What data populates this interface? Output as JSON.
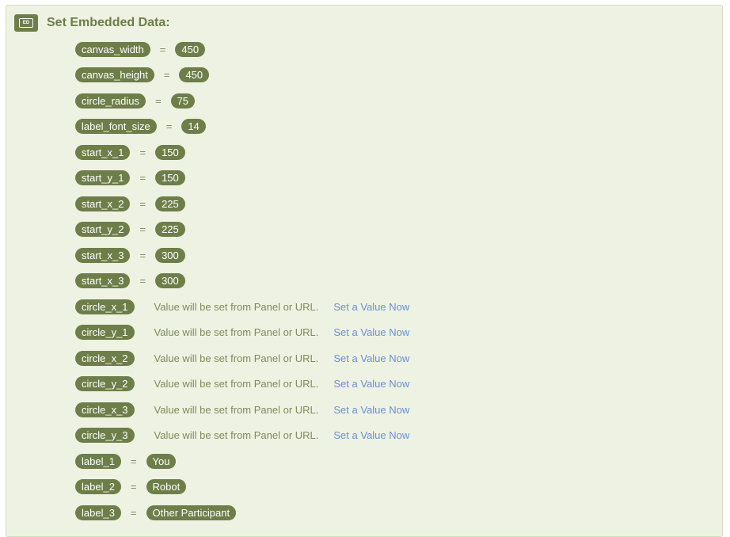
{
  "header": {
    "badge": "ED",
    "title": "Set Embedded Data:"
  },
  "fields": [
    {
      "name": "canvas_width",
      "value": "450"
    },
    {
      "name": "canvas_height",
      "value": "450"
    },
    {
      "name": "circle_radius",
      "value": "75"
    },
    {
      "name": "label_font_size",
      "value": "14"
    },
    {
      "name": "start_x_1",
      "value": "150"
    },
    {
      "name": "start_y_1",
      "value": "150"
    },
    {
      "name": "start_x_2",
      "value": "225"
    },
    {
      "name": "start_y_2",
      "value": "225"
    },
    {
      "name": "start_x_3",
      "value": "300"
    },
    {
      "name": "start_x_3",
      "value": "300"
    },
    {
      "name": "circle_x_1",
      "placeholder": "Value will be set from Panel or URL.",
      "action": "Set a Value Now"
    },
    {
      "name": "circle_y_1",
      "placeholder": "Value will be set from Panel or URL.",
      "action": "Set a Value Now"
    },
    {
      "name": "circle_x_2",
      "placeholder": "Value will be set from Panel or URL.",
      "action": "Set a Value Now"
    },
    {
      "name": "circle_y_2",
      "placeholder": "Value will be set from Panel or URL.",
      "action": "Set a Value Now"
    },
    {
      "name": "circle_x_3",
      "placeholder": "Value will be set from Panel or URL.",
      "action": "Set a Value Now"
    },
    {
      "name": "circle_y_3",
      "placeholder": "Value will be set from Panel or URL.",
      "action": "Set a Value Now"
    },
    {
      "name": "label_1",
      "value": "You"
    },
    {
      "name": "label_2",
      "value": "Robot"
    },
    {
      "name": "label_3",
      "value": "Other Participant"
    }
  ],
  "equals_sign": "="
}
